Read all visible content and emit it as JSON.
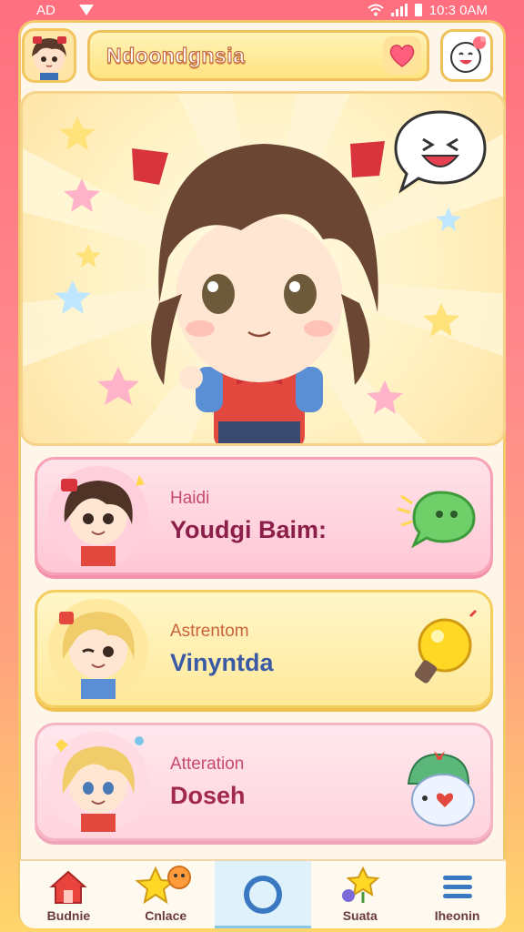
{
  "status": {
    "left_text": "AD",
    "time": "10:3 0AM"
  },
  "header": {
    "title": "Ndoondgnsia",
    "heart_icon": "heart-icon",
    "face_icon": "laughing-face-icon"
  },
  "hero": {
    "speech_icon": "laughing-speech-bubble-icon"
  },
  "cards": [
    {
      "sub": "Haidi",
      "main": "Youdgi Baim:",
      "main_color": "#8c1f4a",
      "icon": "chat-bubble-icon"
    },
    {
      "sub": "Astrentom",
      "main": "Vinyntda",
      "main_color": "#3b5aa5",
      "icon": "lightbulb-icon"
    },
    {
      "sub": "Atteration",
      "main": "Doseh",
      "main_color": "#a1284e",
      "icon": "mascot-icon"
    }
  ],
  "nav": [
    {
      "label": "Budnie",
      "icon": "home-icon"
    },
    {
      "label": "Cnlace",
      "icon": "star-icon"
    },
    {
      "label": "",
      "icon": "circle-icon",
      "active": true
    },
    {
      "label": "Suata",
      "icon": "flower-icon"
    },
    {
      "label": "Iheonin",
      "icon": "menu-icon"
    }
  ],
  "colors": {
    "accent_pink": "#ff6f7f",
    "accent_yellow": "#ffd66b"
  }
}
